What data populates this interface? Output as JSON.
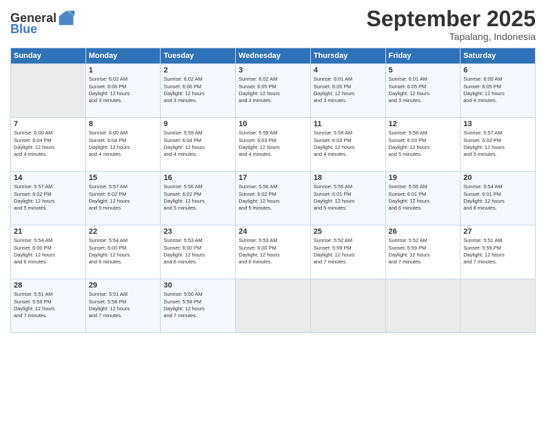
{
  "header": {
    "logo_general": "General",
    "logo_blue": "Blue",
    "month": "September 2025",
    "location": "Tapalang, Indonesia"
  },
  "days_of_week": [
    "Sunday",
    "Monday",
    "Tuesday",
    "Wednesday",
    "Thursday",
    "Friday",
    "Saturday"
  ],
  "weeks": [
    [
      {
        "day": "",
        "info": ""
      },
      {
        "day": "1",
        "info": "Sunrise: 6:02 AM\nSunset: 6:06 PM\nDaylight: 12 hours\nand 3 minutes."
      },
      {
        "day": "2",
        "info": "Sunrise: 6:02 AM\nSunset: 6:06 PM\nDaylight: 12 hours\nand 3 minutes."
      },
      {
        "day": "3",
        "info": "Sunrise: 6:02 AM\nSunset: 6:05 PM\nDaylight: 12 hours\nand 3 minutes."
      },
      {
        "day": "4",
        "info": "Sunrise: 6:01 AM\nSunset: 6:05 PM\nDaylight: 12 hours\nand 3 minutes."
      },
      {
        "day": "5",
        "info": "Sunrise: 6:01 AM\nSunset: 6:05 PM\nDaylight: 12 hours\nand 3 minutes."
      },
      {
        "day": "6",
        "info": "Sunrise: 6:00 AM\nSunset: 6:05 PM\nDaylight: 12 hours\nand 4 minutes."
      }
    ],
    [
      {
        "day": "7",
        "info": "Sunrise: 6:00 AM\nSunset: 6:04 PM\nDaylight: 12 hours\nand 4 minutes."
      },
      {
        "day": "8",
        "info": "Sunrise: 6:00 AM\nSunset: 6:04 PM\nDaylight: 12 hours\nand 4 minutes."
      },
      {
        "day": "9",
        "info": "Sunrise: 5:59 AM\nSunset: 6:04 PM\nDaylight: 12 hours\nand 4 minutes."
      },
      {
        "day": "10",
        "info": "Sunrise: 5:59 AM\nSunset: 6:03 PM\nDaylight: 12 hours\nand 4 minutes."
      },
      {
        "day": "11",
        "info": "Sunrise: 5:58 AM\nSunset: 6:03 PM\nDaylight: 12 hours\nand 4 minutes."
      },
      {
        "day": "12",
        "info": "Sunrise: 5:58 AM\nSunset: 6:03 PM\nDaylight: 12 hours\nand 5 minutes."
      },
      {
        "day": "13",
        "info": "Sunrise: 5:57 AM\nSunset: 6:03 PM\nDaylight: 12 hours\nand 5 minutes."
      }
    ],
    [
      {
        "day": "14",
        "info": "Sunrise: 5:57 AM\nSunset: 6:02 PM\nDaylight: 12 hours\nand 5 minutes."
      },
      {
        "day": "15",
        "info": "Sunrise: 5:57 AM\nSunset: 6:02 PM\nDaylight: 12 hours\nand 5 minutes."
      },
      {
        "day": "16",
        "info": "Sunrise: 5:56 AM\nSunset: 6:02 PM\nDaylight: 12 hours\nand 5 minutes."
      },
      {
        "day": "17",
        "info": "Sunrise: 5:56 AM\nSunset: 6:02 PM\nDaylight: 12 hours\nand 5 minutes."
      },
      {
        "day": "18",
        "info": "Sunrise: 5:55 AM\nSunset: 6:01 PM\nDaylight: 12 hours\nand 5 minutes."
      },
      {
        "day": "19",
        "info": "Sunrise: 5:55 AM\nSunset: 6:01 PM\nDaylight: 12 hours\nand 6 minutes."
      },
      {
        "day": "20",
        "info": "Sunrise: 5:54 AM\nSunset: 6:01 PM\nDaylight: 12 hours\nand 6 minutes."
      }
    ],
    [
      {
        "day": "21",
        "info": "Sunrise: 5:54 AM\nSunset: 6:00 PM\nDaylight: 12 hours\nand 6 minutes."
      },
      {
        "day": "22",
        "info": "Sunrise: 5:54 AM\nSunset: 6:00 PM\nDaylight: 12 hours\nand 6 minutes."
      },
      {
        "day": "23",
        "info": "Sunrise: 5:53 AM\nSunset: 6:00 PM\nDaylight: 12 hours\nand 6 minutes."
      },
      {
        "day": "24",
        "info": "Sunrise: 5:53 AM\nSunset: 6:00 PM\nDaylight: 12 hours\nand 6 minutes."
      },
      {
        "day": "25",
        "info": "Sunrise: 5:52 AM\nSunset: 5:59 PM\nDaylight: 12 hours\nand 7 minutes."
      },
      {
        "day": "26",
        "info": "Sunrise: 5:52 AM\nSunset: 5:59 PM\nDaylight: 12 hours\nand 7 minutes."
      },
      {
        "day": "27",
        "info": "Sunrise: 5:51 AM\nSunset: 5:59 PM\nDaylight: 12 hours\nand 7 minutes."
      }
    ],
    [
      {
        "day": "28",
        "info": "Sunrise: 5:51 AM\nSunset: 5:59 PM\nDaylight: 12 hours\nand 7 minutes."
      },
      {
        "day": "29",
        "info": "Sunrise: 5:51 AM\nSunset: 5:58 PM\nDaylight: 12 hours\nand 7 minutes."
      },
      {
        "day": "30",
        "info": "Sunrise: 5:50 AM\nSunset: 5:58 PM\nDaylight: 12 hours\nand 7 minutes."
      },
      {
        "day": "",
        "info": ""
      },
      {
        "day": "",
        "info": ""
      },
      {
        "day": "",
        "info": ""
      },
      {
        "day": "",
        "info": ""
      }
    ]
  ]
}
